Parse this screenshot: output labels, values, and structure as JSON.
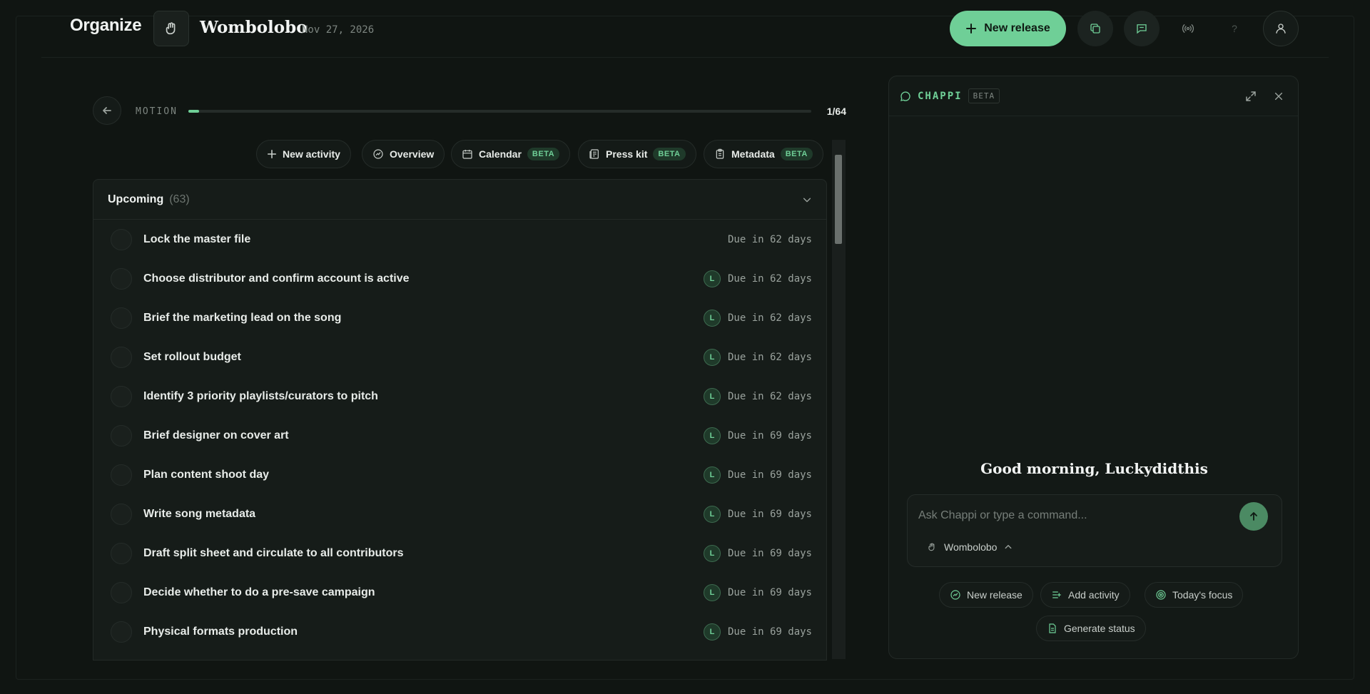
{
  "app": {
    "name": "Organize"
  },
  "project": {
    "name": "Wombolobo",
    "date": "Nov 27, 2026"
  },
  "header": {
    "new_release_label": "New release",
    "help_label": "?"
  },
  "progress": {
    "stage": "MOTION",
    "count_label": "1/64",
    "fraction": 0.017
  },
  "tabs": [
    {
      "label": "New activity",
      "icon": "plus-icon",
      "beta": ""
    },
    {
      "label": "Overview",
      "icon": "overview-icon",
      "beta": ""
    },
    {
      "label": "Calendar",
      "icon": "calendar-icon",
      "beta": "BETA"
    },
    {
      "label": "Press kit",
      "icon": "newspaper-icon",
      "beta": "BETA"
    },
    {
      "label": "Metadata",
      "icon": "clipboard-icon",
      "beta": "BETA"
    }
  ],
  "list": {
    "title": "Upcoming",
    "count": "(63)",
    "items": [
      {
        "title": "Lock the master file",
        "avatar": "",
        "due": "Due in 62 days"
      },
      {
        "title": "Choose distributor and confirm account is active",
        "avatar": "L",
        "due": "Due in 62 days"
      },
      {
        "title": "Brief the marketing lead on the song",
        "avatar": "L",
        "due": "Due in 62 days"
      },
      {
        "title": "Set rollout budget",
        "avatar": "L",
        "due": "Due in 62 days"
      },
      {
        "title": "Identify 3 priority playlists/curators to pitch",
        "avatar": "L",
        "due": "Due in 62 days"
      },
      {
        "title": "Brief designer on cover art",
        "avatar": "L",
        "due": "Due in 69 days"
      },
      {
        "title": "Plan content shoot day",
        "avatar": "L",
        "due": "Due in 69 days"
      },
      {
        "title": "Write song metadata",
        "avatar": "L",
        "due": "Due in 69 days"
      },
      {
        "title": "Draft split sheet and circulate to all contributors",
        "avatar": "L",
        "due": "Due in 69 days"
      },
      {
        "title": "Decide whether to do a pre-save campaign",
        "avatar": "L",
        "due": "Due in 69 days"
      },
      {
        "title": "Physical formats production",
        "avatar": "L",
        "due": "Due in 69 days"
      }
    ]
  },
  "chat": {
    "title": "CHAPPI",
    "beta": "BETA",
    "greeting": "Good morning, Luckydidthis",
    "placeholder": "Ask Chappi or type a command...",
    "context": "Wombolobo",
    "quick_actions": [
      "New release",
      "Add activity",
      "Today's focus",
      "Generate status"
    ]
  },
  "colors": {
    "accent": "#6fcf97",
    "background": "#101512",
    "panel": "#161c19"
  }
}
